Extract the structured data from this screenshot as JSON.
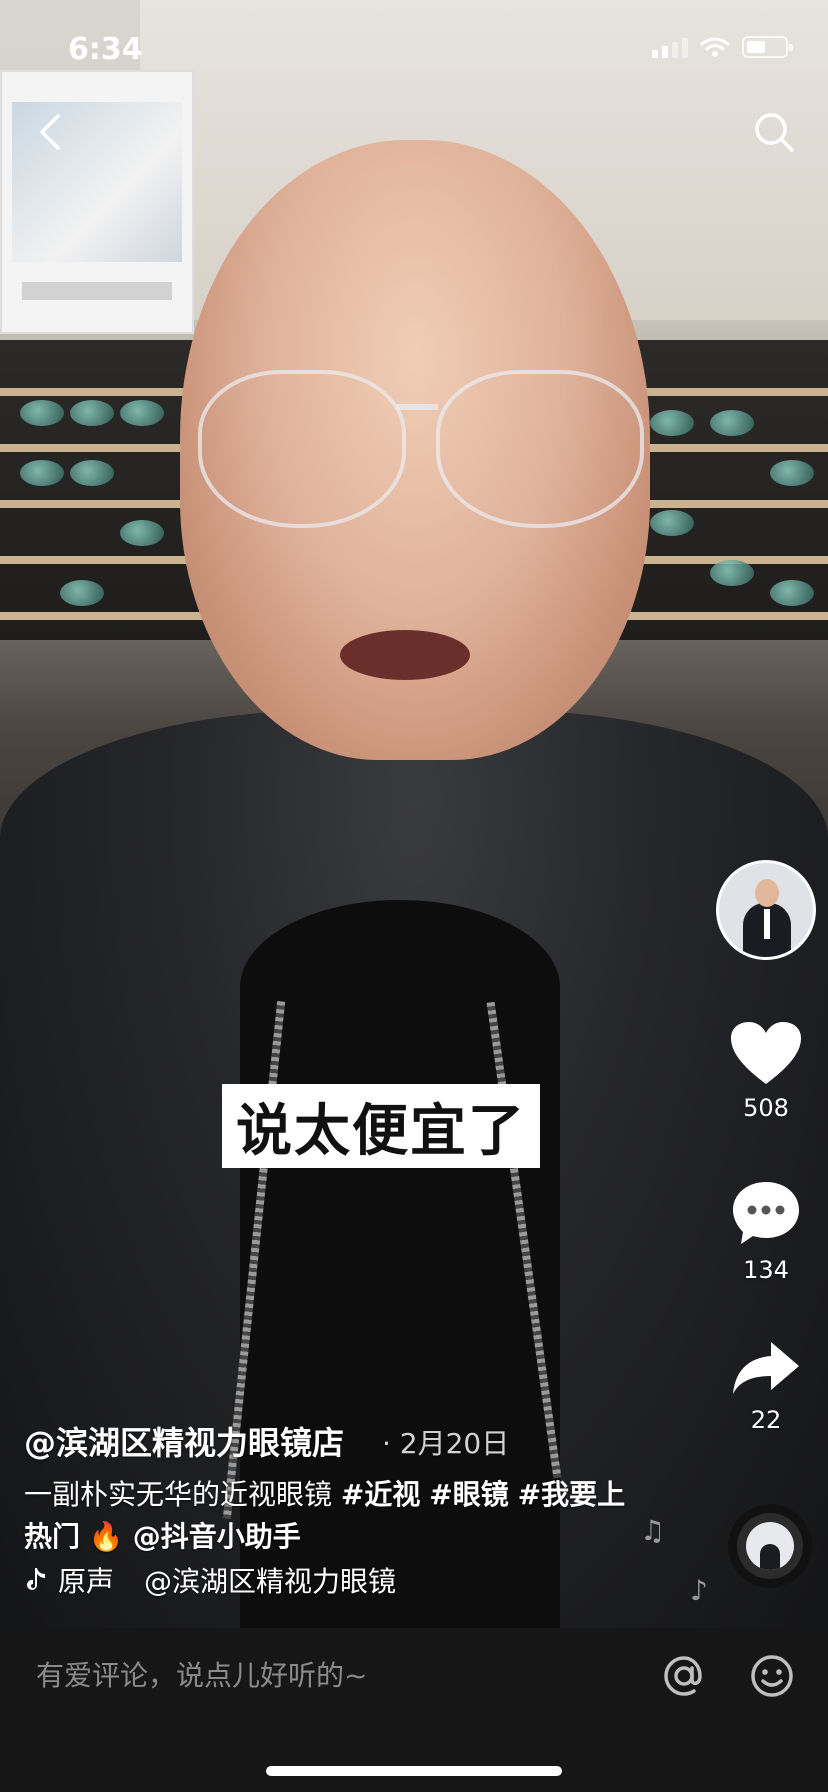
{
  "status_bar": {
    "time": "6:34"
  },
  "icons": {
    "back": "chevron-left-icon",
    "search": "search-icon",
    "like": "heart-icon",
    "comment": "comment-bubble-icon",
    "share": "share-arrow-icon",
    "music": "tiktok-note-icon",
    "mention": "at-icon",
    "emoji": "smile-icon"
  },
  "video": {
    "caption": "说太便宜了"
  },
  "actions": {
    "likes": "508",
    "comments": "134",
    "shares": "22"
  },
  "post": {
    "author": "@滨湖区精视力眼镜店",
    "date": "· 2月20日",
    "description_text": "一副朴实无华的近视眼镜 ",
    "tags": [
      "#近视",
      "#眼镜",
      "#我要上热门"
    ],
    "fire_emoji": "🔥",
    "mention": "@抖音小助手",
    "music_label": "原声",
    "music_author": "@滨湖区精视力眼镜"
  },
  "comment_bar": {
    "placeholder": "有爱评论，说点儿好听的~"
  },
  "colors": {
    "background": "#000000",
    "bottom_bar": "#161616",
    "text": "#ffffff",
    "placeholder": "#8a8a8a"
  }
}
